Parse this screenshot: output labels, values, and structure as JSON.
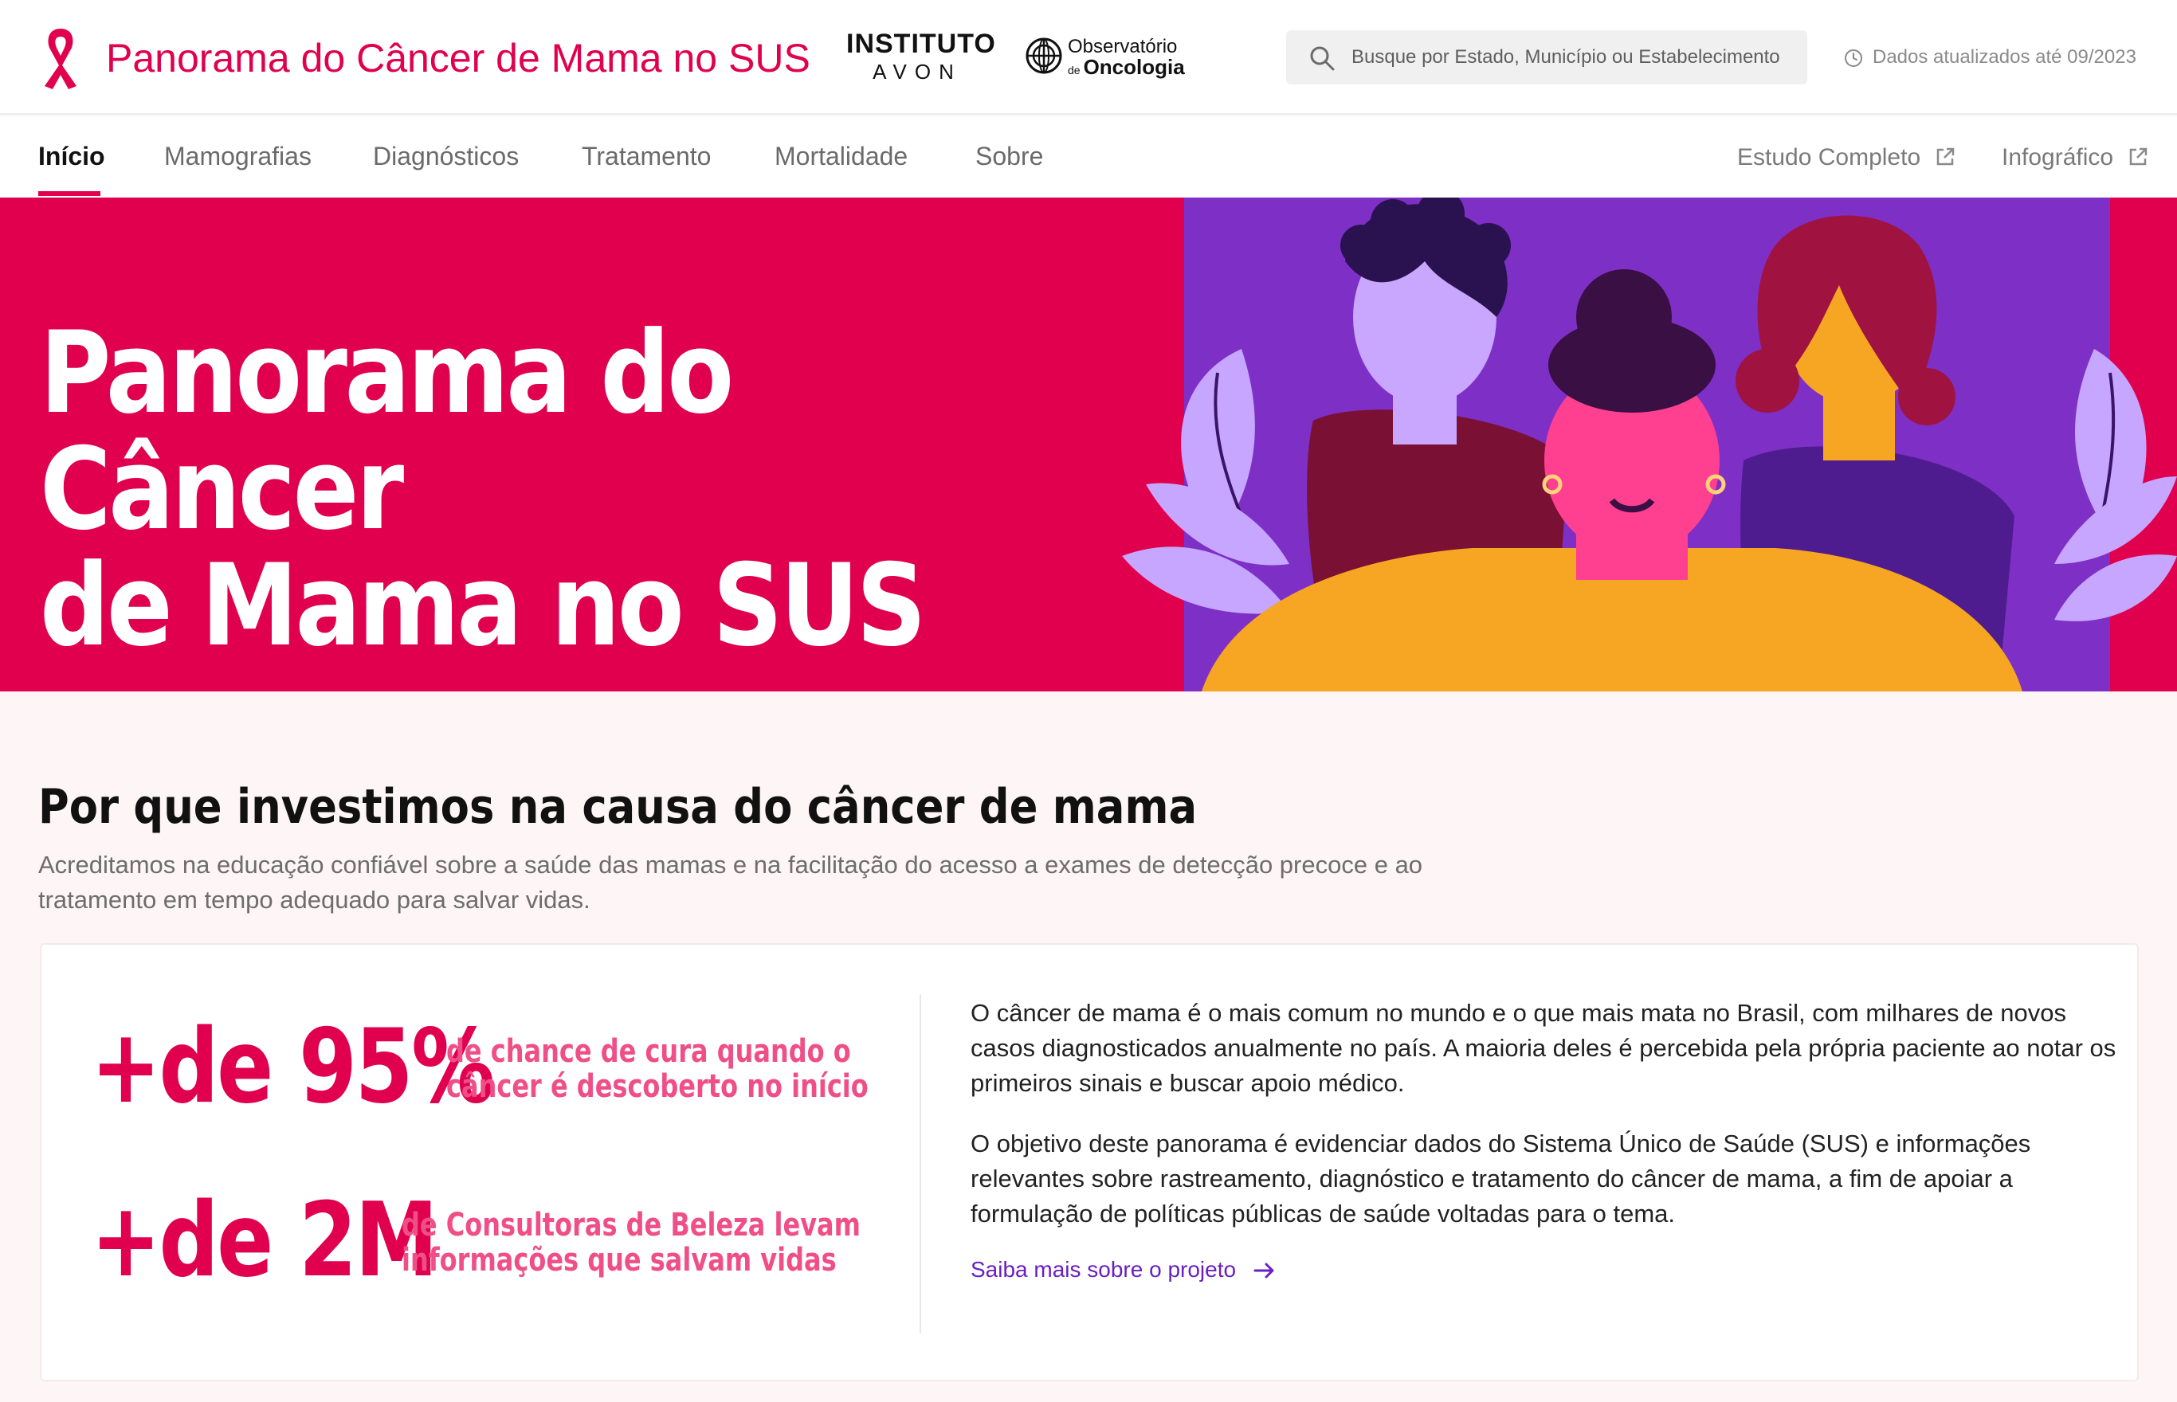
{
  "header": {
    "title": "Panorama do Câncer de Mama no SUS",
    "partner1_line1": "INSTITUTO",
    "partner1_line2": "AVON",
    "partner2_line1": "Observatório",
    "partner2_small": "de",
    "partner2_line2": "Oncologia",
    "search_placeholder": "Busque por Estado, Município ou Estabelecimento",
    "updated": "Dados atualizados até 09/2023",
    "brand_color": "#e0004d"
  },
  "nav": {
    "items": [
      "Início",
      "Mamografias",
      "Diagnósticos",
      "Tratamento",
      "Mortalidade",
      "Sobre"
    ],
    "active": "Início",
    "external": [
      "Estudo Completo",
      "Infográfico"
    ]
  },
  "hero": {
    "title_line1": "Panorama do Câncer",
    "title_line2": "de Mama no SUS"
  },
  "intro": {
    "heading": "Por que investimos na causa do câncer de mama",
    "text": "Acreditamos na educação confiável sobre a saúde das mamas e na facilitação do acesso a exames de detecção precoce e ao tratamento em tempo adequado para salvar vidas."
  },
  "stats": [
    {
      "value": "+de 95%",
      "line1": "de chance de cura quando o",
      "line2": "câncer é descoberto no início"
    },
    {
      "value": "+de 2M",
      "line1": "de Consultoras de Beleza levam",
      "line2": "informações que salvam vidas"
    }
  ],
  "about": {
    "p1": "O câncer de mama é o mais comum no mundo e o que mais mata no Brasil, com milhares de novos casos diagnosticados anualmente no país. A maioria deles é percebida pela própria paciente ao notar os primeiros sinais e buscar apoio médico.",
    "p2": "O objetivo deste panorama é evidenciar dados do Sistema Único de Saúde (SUS) e informações relevantes sobre rastreamento, diagnóstico e tratamento do câncer de mama, a fim de apoiar a formulação de políticas públicas de saúde voltadas para o tema.",
    "link": "Saiba mais sobre o projeto",
    "link_color": "#6a1fc0"
  }
}
